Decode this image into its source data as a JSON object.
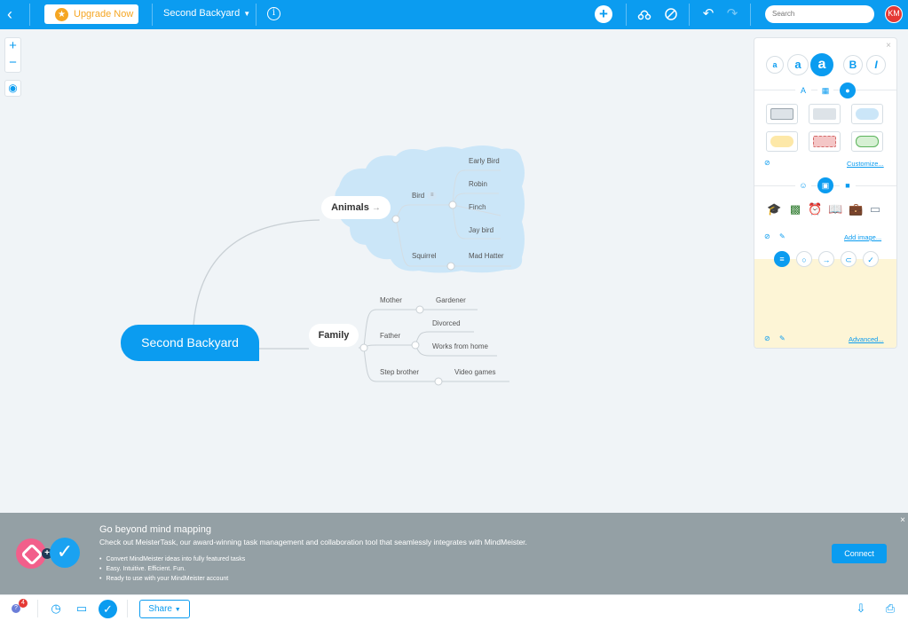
{
  "topbar": {
    "upgrade_label": "Upgrade Now",
    "map_title": "Second Backyard",
    "search_placeholder": "Search",
    "user_initials": "KM"
  },
  "zoom": {
    "in_label": "+",
    "out_label": "−"
  },
  "mindmap": {
    "root": "Second Backyard",
    "animals": {
      "label": "Animals",
      "bird": {
        "label": "Bird",
        "children": [
          "Early Bird",
          "Robin",
          "Finch",
          "Jay bird"
        ]
      },
      "squirrel": {
        "label": "Squirrel",
        "children": [
          "Mad Hatter"
        ]
      }
    },
    "family": {
      "label": "Family",
      "mother": {
        "label": "Mother",
        "children": [
          "Gardener"
        ]
      },
      "father": {
        "label": "Father",
        "children": [
          "Divorced",
          "Works from home"
        ]
      },
      "step_brother": {
        "label": "Step brother",
        "children": [
          "Video games"
        ]
      }
    }
  },
  "panel": {
    "font_sizes": [
      "a",
      "a",
      "a"
    ],
    "bold_label": "B",
    "italic_label": "I",
    "customize_link": "Customize...",
    "add_image_link": "Add image...",
    "advanced_link": "Advanced..."
  },
  "promo": {
    "title": "Go beyond mind mapping",
    "subtitle": "Check out MeisterTask, our award-winning task management and collaboration tool that seamlessly integrates with MindMeister.",
    "bullets": [
      "Convert MindMeister ideas into fully featured tasks",
      "Easy. Intuitive. Efficient. Fun.",
      "Ready to use with your MindMeister account"
    ],
    "connect_label": "Connect"
  },
  "bottombar": {
    "notification_count": "4",
    "share_label": "Share"
  },
  "colors": {
    "accent": "#0b9cf0",
    "cloud": "#cbe6f8",
    "promo_bg": "#94a0a5",
    "notes_bg": "#fdf5d6"
  }
}
